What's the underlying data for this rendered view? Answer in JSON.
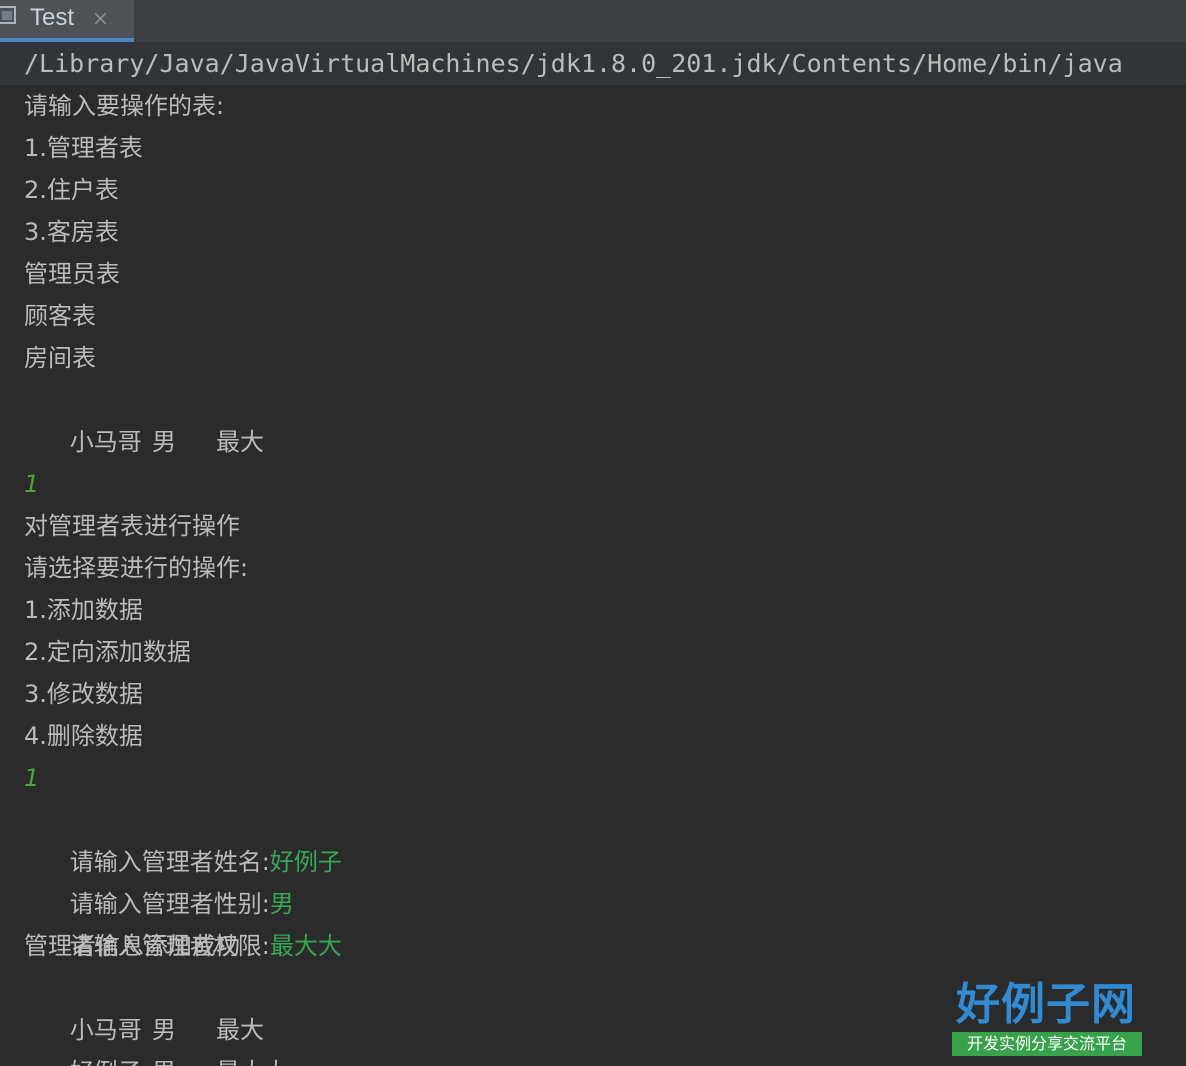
{
  "tab": {
    "title": "Test",
    "close": "×"
  },
  "console": {
    "command": "/Library/Java/JavaVirtualMachines/jdk1.8.0_201.jdk/Contents/Home/bin/java",
    "lines": [
      "请输入要操作的表:",
      "1.管理者表",
      "2.住户表",
      "3.客房表",
      "管理员表",
      "顾客表",
      "房间表"
    ],
    "row1": [
      "小马哥",
      "男",
      "最大"
    ],
    "input1": "1",
    "lines2": [
      "对管理者表进行操作",
      "请选择要进行的操作:",
      "1.添加数据",
      "2.定向添加数据",
      "3.修改数据",
      "4.删除数据"
    ],
    "input2": "1",
    "prompts": [
      {
        "label": "请输入管理者姓名:",
        "value": "好例子"
      },
      {
        "label": "请输入管理者性别:",
        "value": "男"
      },
      {
        "label": "请输入管理者权限:",
        "value": "最大大"
      }
    ],
    "success": "管理者信息添加成功",
    "row2": [
      "小马哥",
      "男",
      "最大"
    ],
    "row3": [
      "好例子",
      "男",
      "最大大"
    ]
  },
  "watermark": {
    "title": "好例子网",
    "subtitle": "开发实例分享交流平台"
  }
}
